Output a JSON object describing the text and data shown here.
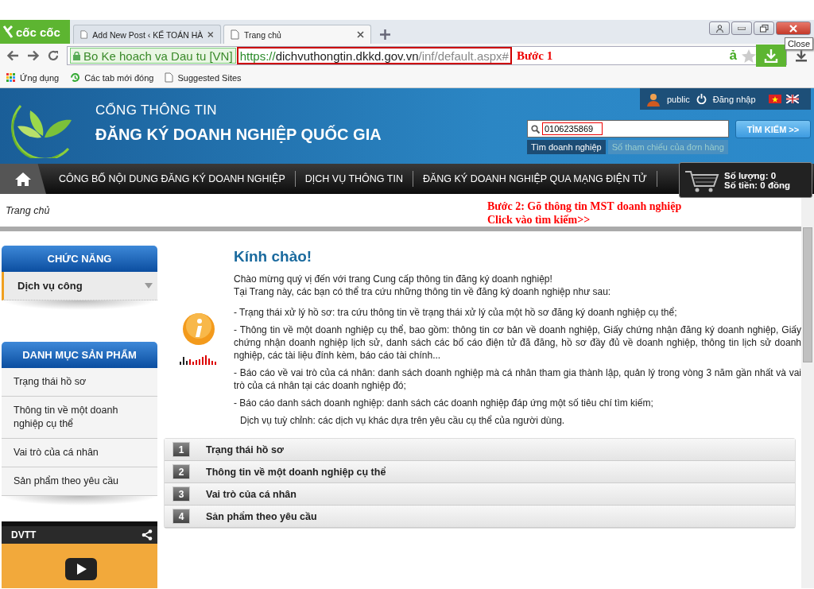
{
  "browser": {
    "logo": "cốc cốc",
    "tabs": [
      {
        "label": "Add New Post ‹ KẾ TOÁN HÀ",
        "selected": false
      },
      {
        "label": "Trang chủ",
        "selected": true
      }
    ],
    "tooltip": "Close",
    "site_identity": "Bo Ke hoach va Dau tu [VN]",
    "url_scheme": "https://",
    "url_host": "dichvuthongtin.dkkd.gov.vn",
    "url_path": "/inf/default.aspx#",
    "annotation": "Bước 1",
    "extension_label": "ả",
    "bookmarks": [
      {
        "kind": "apps",
        "label": "Ứng dụng"
      },
      {
        "kind": "recent",
        "label": "Các tab mới đóng"
      },
      {
        "kind": "page",
        "label": "Suggested Sites"
      }
    ]
  },
  "header": {
    "title_small": "CỔNG THÔNG TIN",
    "title_big": "ĐĂNG KÝ DOANH NGHIỆP QUỐC GIA",
    "user": "public",
    "login": "Đăng nhập",
    "search_value": "0106235869",
    "search_button": "TÌM KIẾM >>",
    "search_tabs": [
      {
        "label": "Tìm doanh nghiệp",
        "selected": true
      },
      {
        "label": "Số tham chiếu của đơn hàng",
        "selected": false
      }
    ]
  },
  "nav": {
    "items": [
      "CÔNG BỐ NỘI DUNG ĐĂNG KÝ DOANH NGHIỆP",
      "DỊCH VỤ THÔNG TIN",
      "ĐĂNG KÝ DOANH NGHIỆP QUA MẠNG ĐIỆN TỬ"
    ],
    "cart_quantity": "Số lượng: 0",
    "cart_amount": "Số tiền: 0 đồng"
  },
  "breadcrumb": "Trang chủ",
  "annotation": [
    "Bước 2: Gõ thông tin MST doanh nghiệp",
    "Click vào tìm kiếm>>"
  ],
  "sidebar": {
    "sections": [
      {
        "title": "CHỨC NĂNG",
        "kind": "dropdown",
        "items": [
          {
            "label": "Dịch vụ công",
            "selected": true
          }
        ]
      },
      {
        "title": "DANH MỤC SẢN PHẨM",
        "kind": "list",
        "items": [
          {
            "label": "Trạng thái hồ sơ",
            "selected": false
          },
          {
            "label": "Thông tin về một doanh nghiệp cụ thể",
            "selected": false
          },
          {
            "label": "Vai trò của cá nhân",
            "selected": false
          },
          {
            "label": "Sản phẩm theo yêu cầu",
            "selected": false
          }
        ]
      }
    ],
    "video_title": "DVTT"
  },
  "main": {
    "heading": "Kính chào!",
    "intro": [
      "Chào mừng quý vị đến với trang Cung cấp thông tin đăng ký doanh nghiệp!",
      "Tại Trang này, các bạn có thể tra cứu những thông tin về đăng ký doanh nghiệp như sau:"
    ],
    "bullets": [
      "- Trạng thái xử lý hồ sơ: tra cứu thông tin về trạng thái xử lý của một hồ sơ đăng ký doanh nghiệp cụ thể;",
      "- Thông tin về một doanh nghiệp cụ thể, bao gồm: thông tin cơ bản về doanh nghiệp, Giấy chứng nhận đăng ký doanh nghiệp, Giấy chứng nhận doanh nghiệp lịch sử, danh sách các bố cáo điện tử đã đăng, hồ sơ đầy đủ về doanh nghiệp, thông tin lịch sử doanh nghiệp, các tài liệu đính kèm, báo cáo tài chính...",
      "- Báo cáo về vai trò của cá nhân: danh sách doanh nghiệp mà cá nhân tham gia thành lập, quản lý trong vòng 3 năm gần nhất và vai trò của cá nhân tại các doanh nghiệp đó;",
      "- Báo cáo danh sách doanh nghiệp: danh sách các doanh nghiệp đáp ứng một số tiêu chí tìm kiếm;"
    ],
    "note": "Dịch vụ tuỳ chỉnh: các dịch vụ khác dựa trên yêu cầu cụ thể của người dùng.",
    "accordion": [
      {
        "number": "1",
        "label": "Trạng thái hồ sơ"
      },
      {
        "number": "2",
        "label": "Thông tin về một doanh nghiệp cụ thể"
      },
      {
        "number": "3",
        "label": "Vai trò của cá nhân"
      },
      {
        "number": "4",
        "label": "Sản phẩm theo yêu cầu"
      }
    ]
  }
}
